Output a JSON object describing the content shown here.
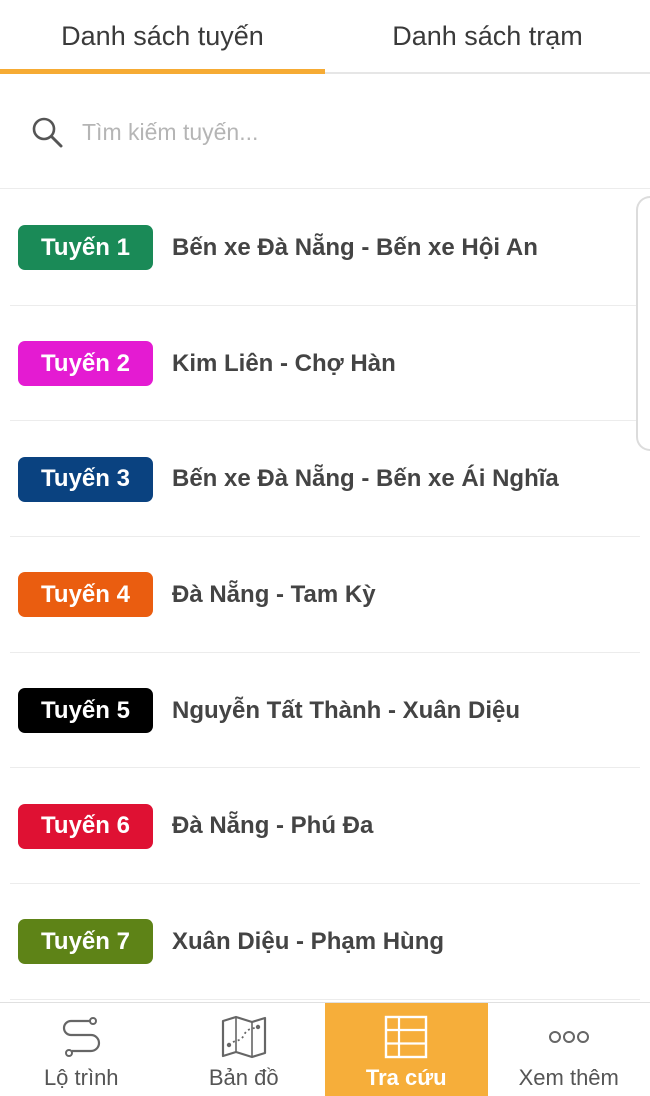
{
  "tabs": [
    {
      "label": "Danh sách tuyến",
      "active": true
    },
    {
      "label": "Danh sách trạm",
      "active": false
    }
  ],
  "search": {
    "placeholder": "Tìm kiếm tuyến...",
    "value": "",
    "icon": "search-icon"
  },
  "routes": [
    {
      "badge": "Tuyến 1",
      "name": "Bến xe Đà Nẵng - Bến xe Hội An",
      "color": "#1a8a57"
    },
    {
      "badge": "Tuyến 2",
      "name": "Kim Liên - Chợ Hàn",
      "color": "#e41bd2"
    },
    {
      "badge": "Tuyến 3",
      "name": "Bến xe Đà Nẵng - Bến xe Ái Nghĩa",
      "color": "#0a4280"
    },
    {
      "badge": "Tuyến 4",
      "name": "Đà Nẵng - Tam Kỳ",
      "color": "#ea5d10"
    },
    {
      "badge": "Tuyến 5",
      "name": "Nguyễn Tất Thành - Xuân Diệu",
      "color": "#000000"
    },
    {
      "badge": "Tuyến 6",
      "name": "Đà Nẵng - Phú Đa",
      "color": "#df1133"
    },
    {
      "badge": "Tuyến 7",
      "name": "Xuân Diệu - Phạm Hùng",
      "color": "#5e8317"
    }
  ],
  "bottom_nav": [
    {
      "label": "Lộ trình",
      "icon": "route-icon",
      "active": false
    },
    {
      "label": "Bản đồ",
      "icon": "map-icon",
      "active": false
    },
    {
      "label": "Tra cứu",
      "icon": "grid-icon",
      "active": true
    },
    {
      "label": "Xem thêm",
      "icon": "more-icon",
      "active": false
    }
  ],
  "colors": {
    "accent": "#f6ab34",
    "active_nav_bg": "#f6ae3a"
  }
}
